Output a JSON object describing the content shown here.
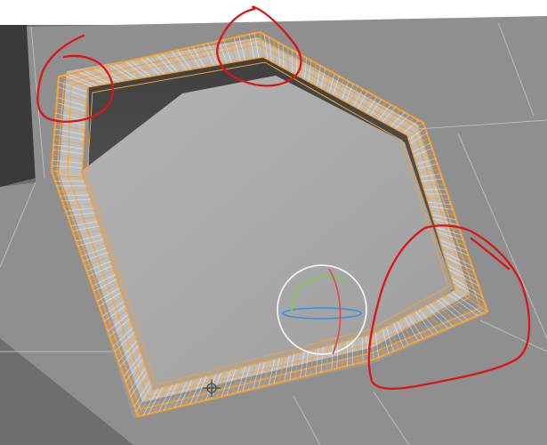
{
  "viewport": {
    "background": "#3a3a3a",
    "top_band_color": "#ffffff",
    "far_surface_color": "#6e6e6e",
    "surface_color": "#8f8f8f",
    "inner_floor_color": "#a7a7a7",
    "inner_wall_dark": "#4a4a4a",
    "inner_wall_mid": "#6a6a6a",
    "ledge_color": "#bdbdbd",
    "outer_face_color": "#9a9a9a",
    "grid_line_color": "#bcbcbc"
  },
  "selection": {
    "outline_color": "#f7a030",
    "wire_color": "#ffffff",
    "state": "edit-mode-selected"
  },
  "gizmo": {
    "ring_color": "#f2f2f2",
    "x_axis_color": "#e04646",
    "y_axis_color": "#7ad14a",
    "z_axis_color": "#3c8ce8"
  },
  "cursor_3d": {
    "icon": "crosshair-cursor-icon"
  },
  "annotations": {
    "stroke_color": "#dc1414",
    "count": 3
  }
}
